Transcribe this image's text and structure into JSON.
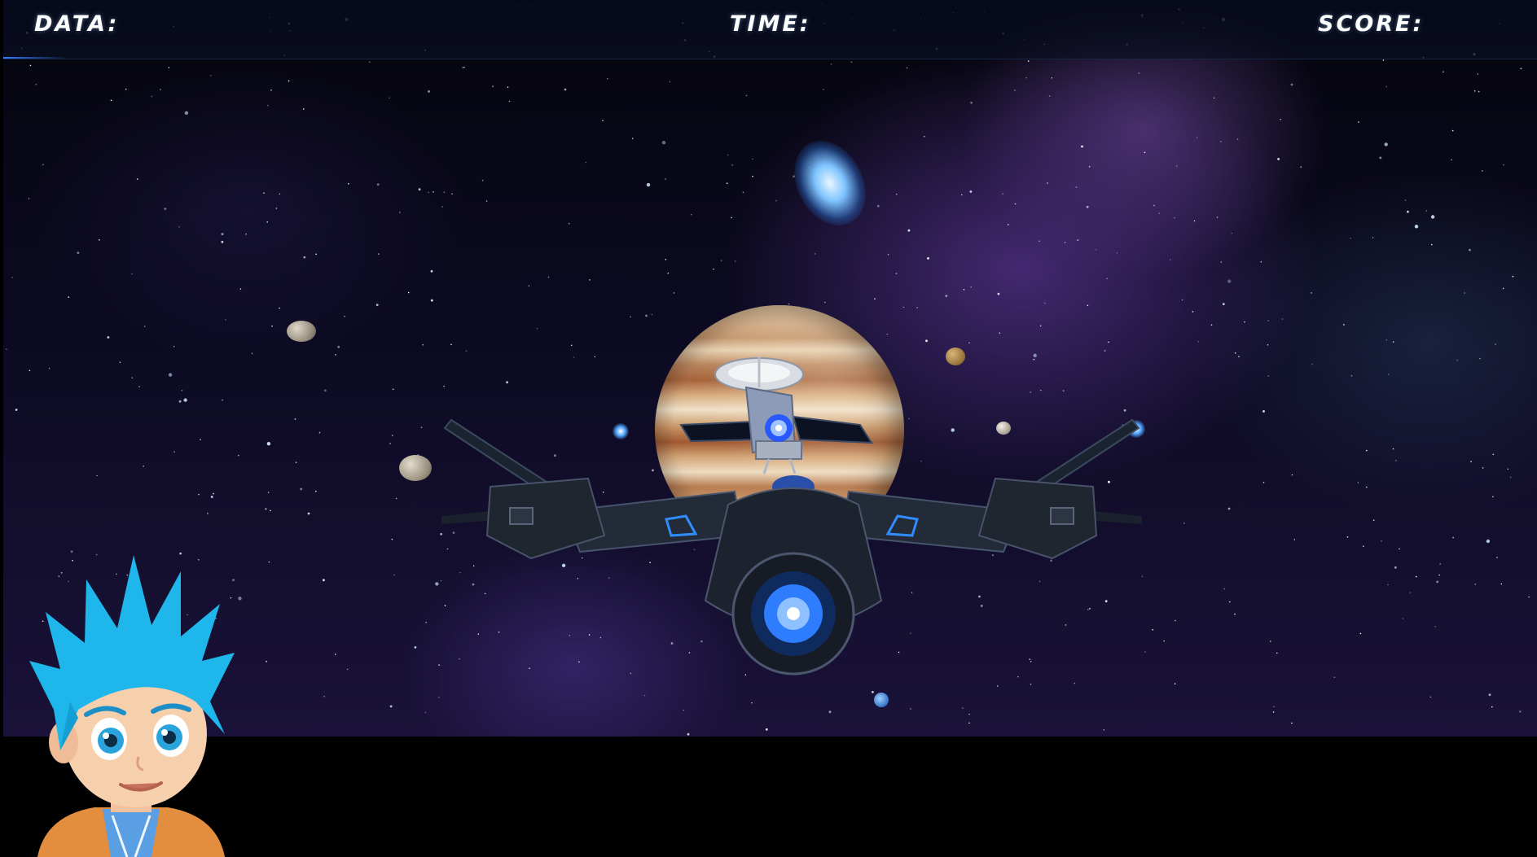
{
  "hud": {
    "data_label": "DATA:",
    "time_label": "TIME:",
    "score_label": "SCORE:"
  },
  "scene": {
    "objects": [
      "galaxy",
      "jupiter",
      "satellite",
      "spaceship",
      "moons"
    ],
    "character": "blue-haired-pilot"
  },
  "colors": {
    "hud_text": "#ffffff",
    "accent_blue": "#2f7dff",
    "engine_glow": "#4ea2ff",
    "hair_blue": "#1fb6ec"
  }
}
